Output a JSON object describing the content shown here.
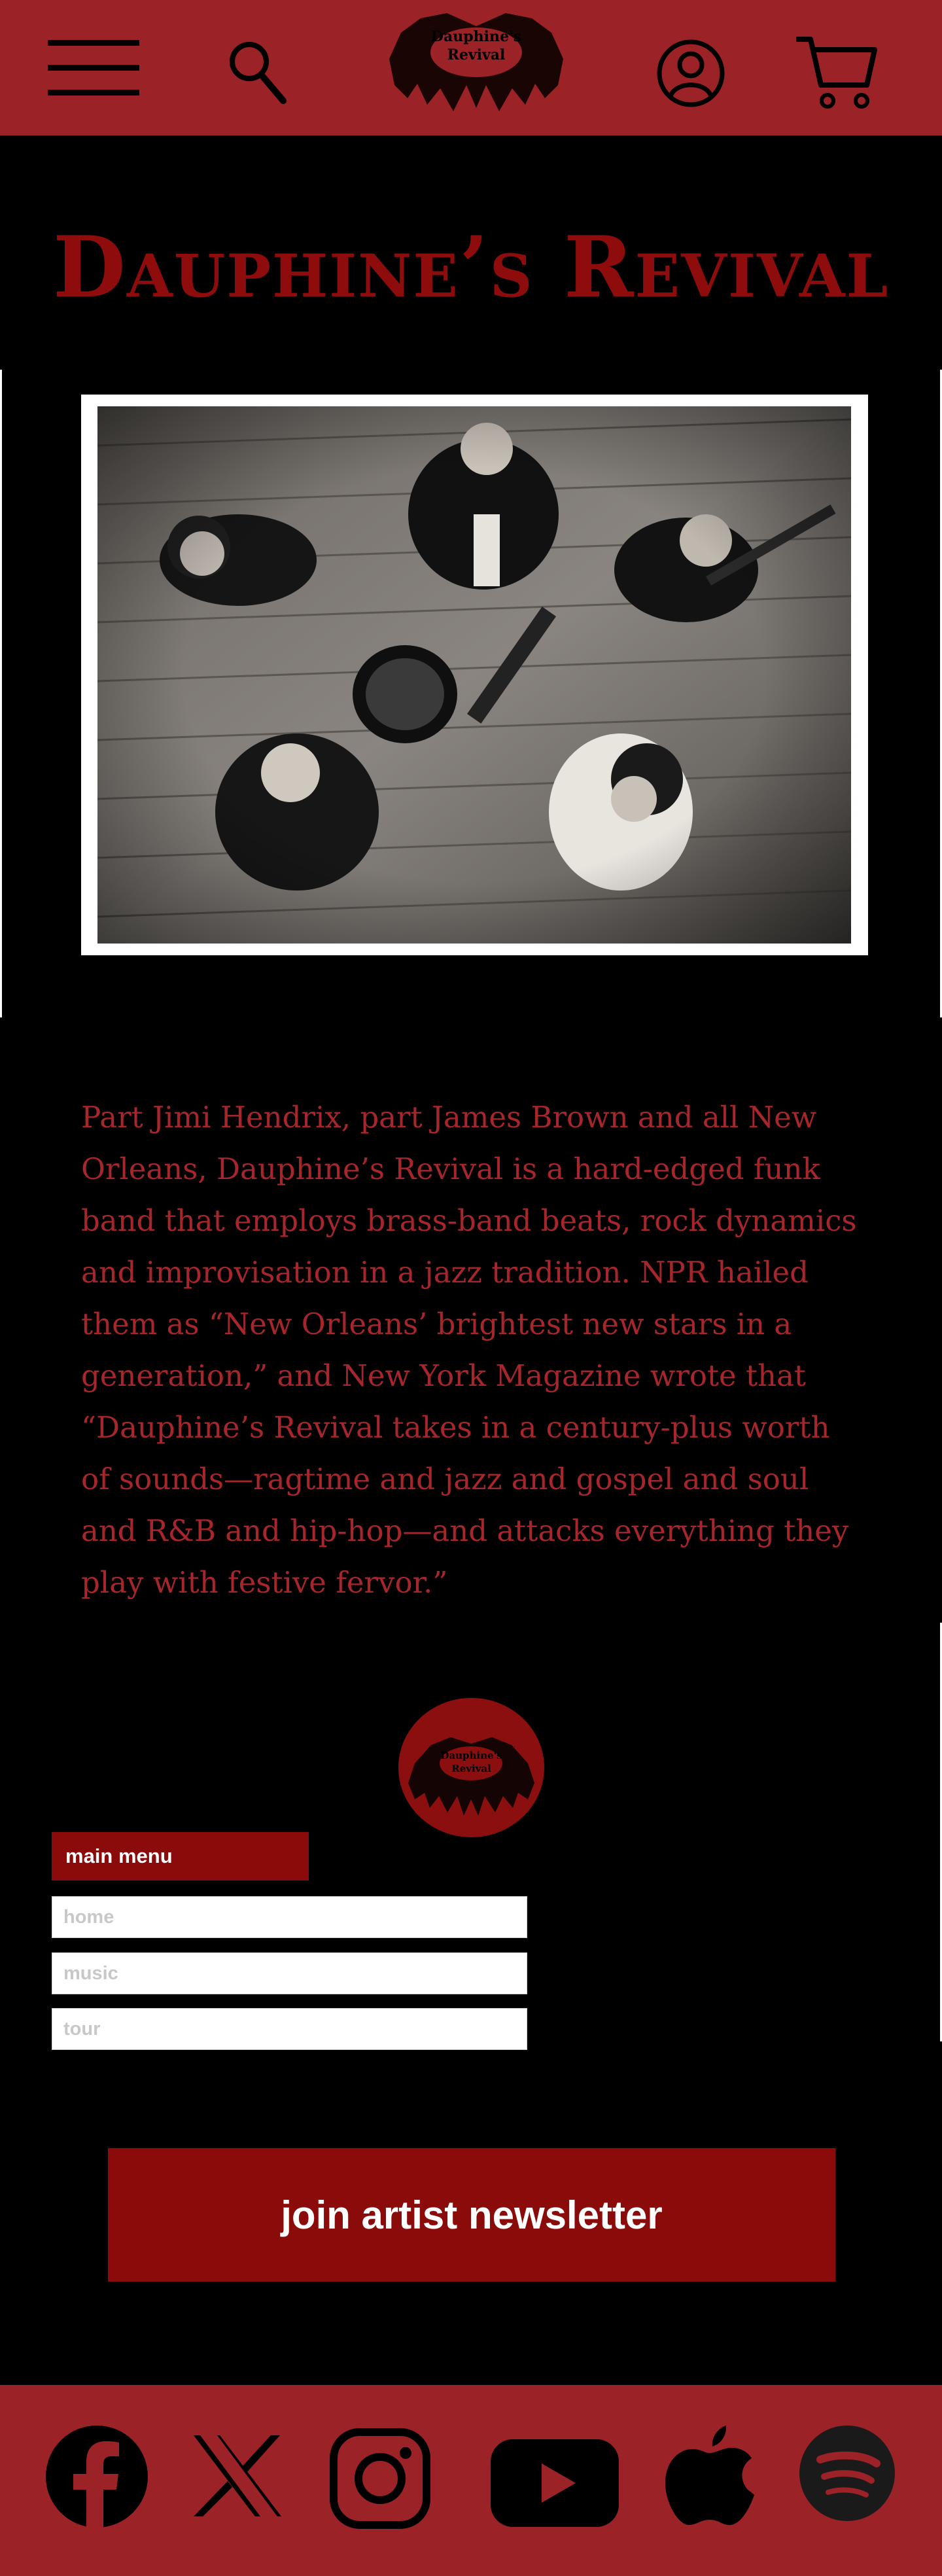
{
  "header": {
    "menu_icon": "hamburger-menu-icon",
    "search_icon": "search-icon",
    "logo_text_line1": "Dauphine's",
    "logo_text_line2": "Revival",
    "account_icon": "user-account-icon",
    "cart_icon": "shopping-cart-icon"
  },
  "hero": {
    "title": "Dauphine’s Revival"
  },
  "bio": {
    "text": "Part Jimi Hendrix, part James Brown and all New Orleans, Dauphine’s Revival is a hard-edged funk band that employs brass-band beats, rock dynamics and improvisation in a jazz tradition. NPR hailed them as “New Orleans’ brightest new stars in a generation,” and New York Magazine wrote that “Dauphine’s Revival takes in a century-plus worth of sounds—ragtime and jazz and gospel and soul and R&B and hip-hop—and attacks everything they play with festive fervor.”"
  },
  "footer_logo": {
    "line1": "Dauphine's",
    "line2": "Revival"
  },
  "menu": {
    "heading": "main menu",
    "items": [
      {
        "label": "home"
      },
      {
        "label": "music"
      },
      {
        "label": "tour"
      }
    ]
  },
  "newsletter": {
    "label": "join artist newsletter"
  },
  "social": {
    "icons": [
      "facebook-icon",
      "x-icon",
      "instagram-icon",
      "youtube-icon",
      "apple-music-icon",
      "spotify-icon"
    ]
  },
  "colors": {
    "header_bg": "#9b2226",
    "accent": "#8b0a0a",
    "title": "#8e0c0c",
    "bio_text": "#a6262c",
    "background": "#000000"
  }
}
